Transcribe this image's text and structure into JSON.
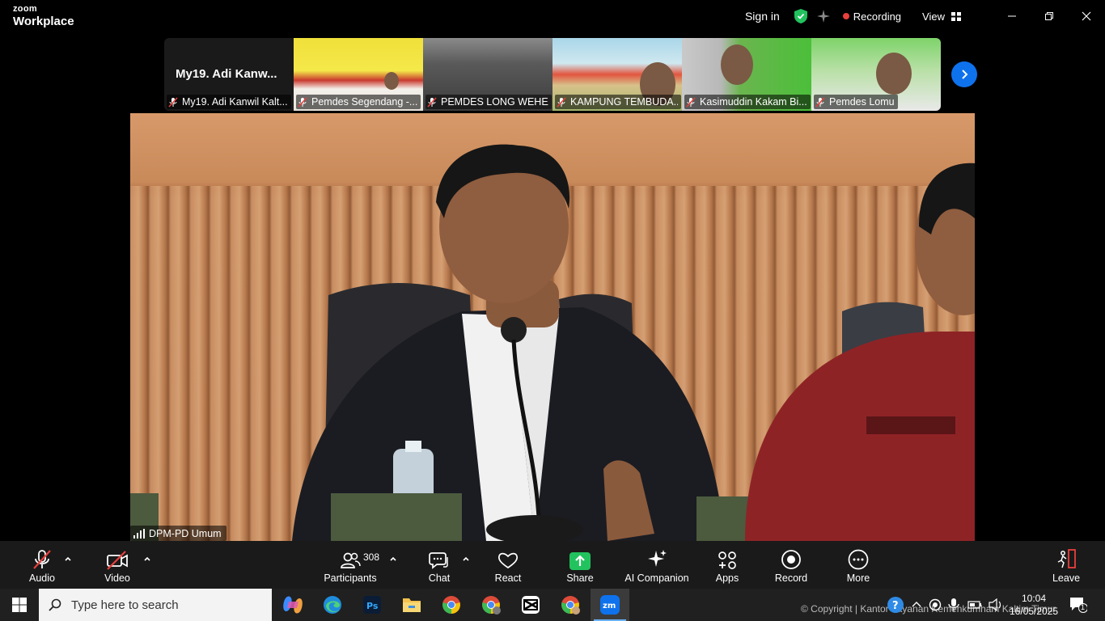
{
  "app": {
    "brand_top": "zoom",
    "brand_bottom": "Workplace",
    "sign_in": "Sign in",
    "recording_label": "Recording",
    "view_label": "View"
  },
  "thumbnails": [
    {
      "big_name": "My19. Adi Kanw...",
      "caption": "My19. Adi Kanwil Kalt...",
      "muted": true
    },
    {
      "caption": "Pemdes Segendang -...",
      "muted": true
    },
    {
      "caption": "PEMDES LONG WEHEA",
      "muted": true
    },
    {
      "caption": "KAMPUNG TEMBUDA...",
      "muted": true
    },
    {
      "caption": "Kasimuddin Kakam Bi...",
      "muted": true
    },
    {
      "caption": "Pemdes Lomu",
      "muted": true
    }
  ],
  "main_video": {
    "participant_label": "DPM-PD Umum"
  },
  "toolbar": {
    "audio": "Audio",
    "video": "Video",
    "participants": "Participants",
    "participants_count": "308",
    "chat": "Chat",
    "react": "React",
    "share": "Share",
    "ai_companion": "AI Companion",
    "apps": "Apps",
    "record": "Record",
    "more": "More",
    "leave": "Leave"
  },
  "taskbar": {
    "search_placeholder": "Type here to search",
    "copyright": "© Copyright | Kantor Layanan Kemenkumham Kaltim Timur",
    "time": "10:04",
    "date": "16/05/2025",
    "notification_count": "1",
    "apps": [
      "copilot-icon",
      "edge-icon",
      "photoshop-icon",
      "file-explorer-icon",
      "chrome-icon",
      "chrome-profile-icon",
      "capcut-icon",
      "chrome-alt-icon",
      "zoom-icon"
    ]
  },
  "colors": {
    "zoom_blue": "#0e72ed",
    "share_green": "#22c35e",
    "mute_red": "#e8403c",
    "toolbar_bg": "#1a1a1a",
    "taskbar_bg": "#202020"
  }
}
